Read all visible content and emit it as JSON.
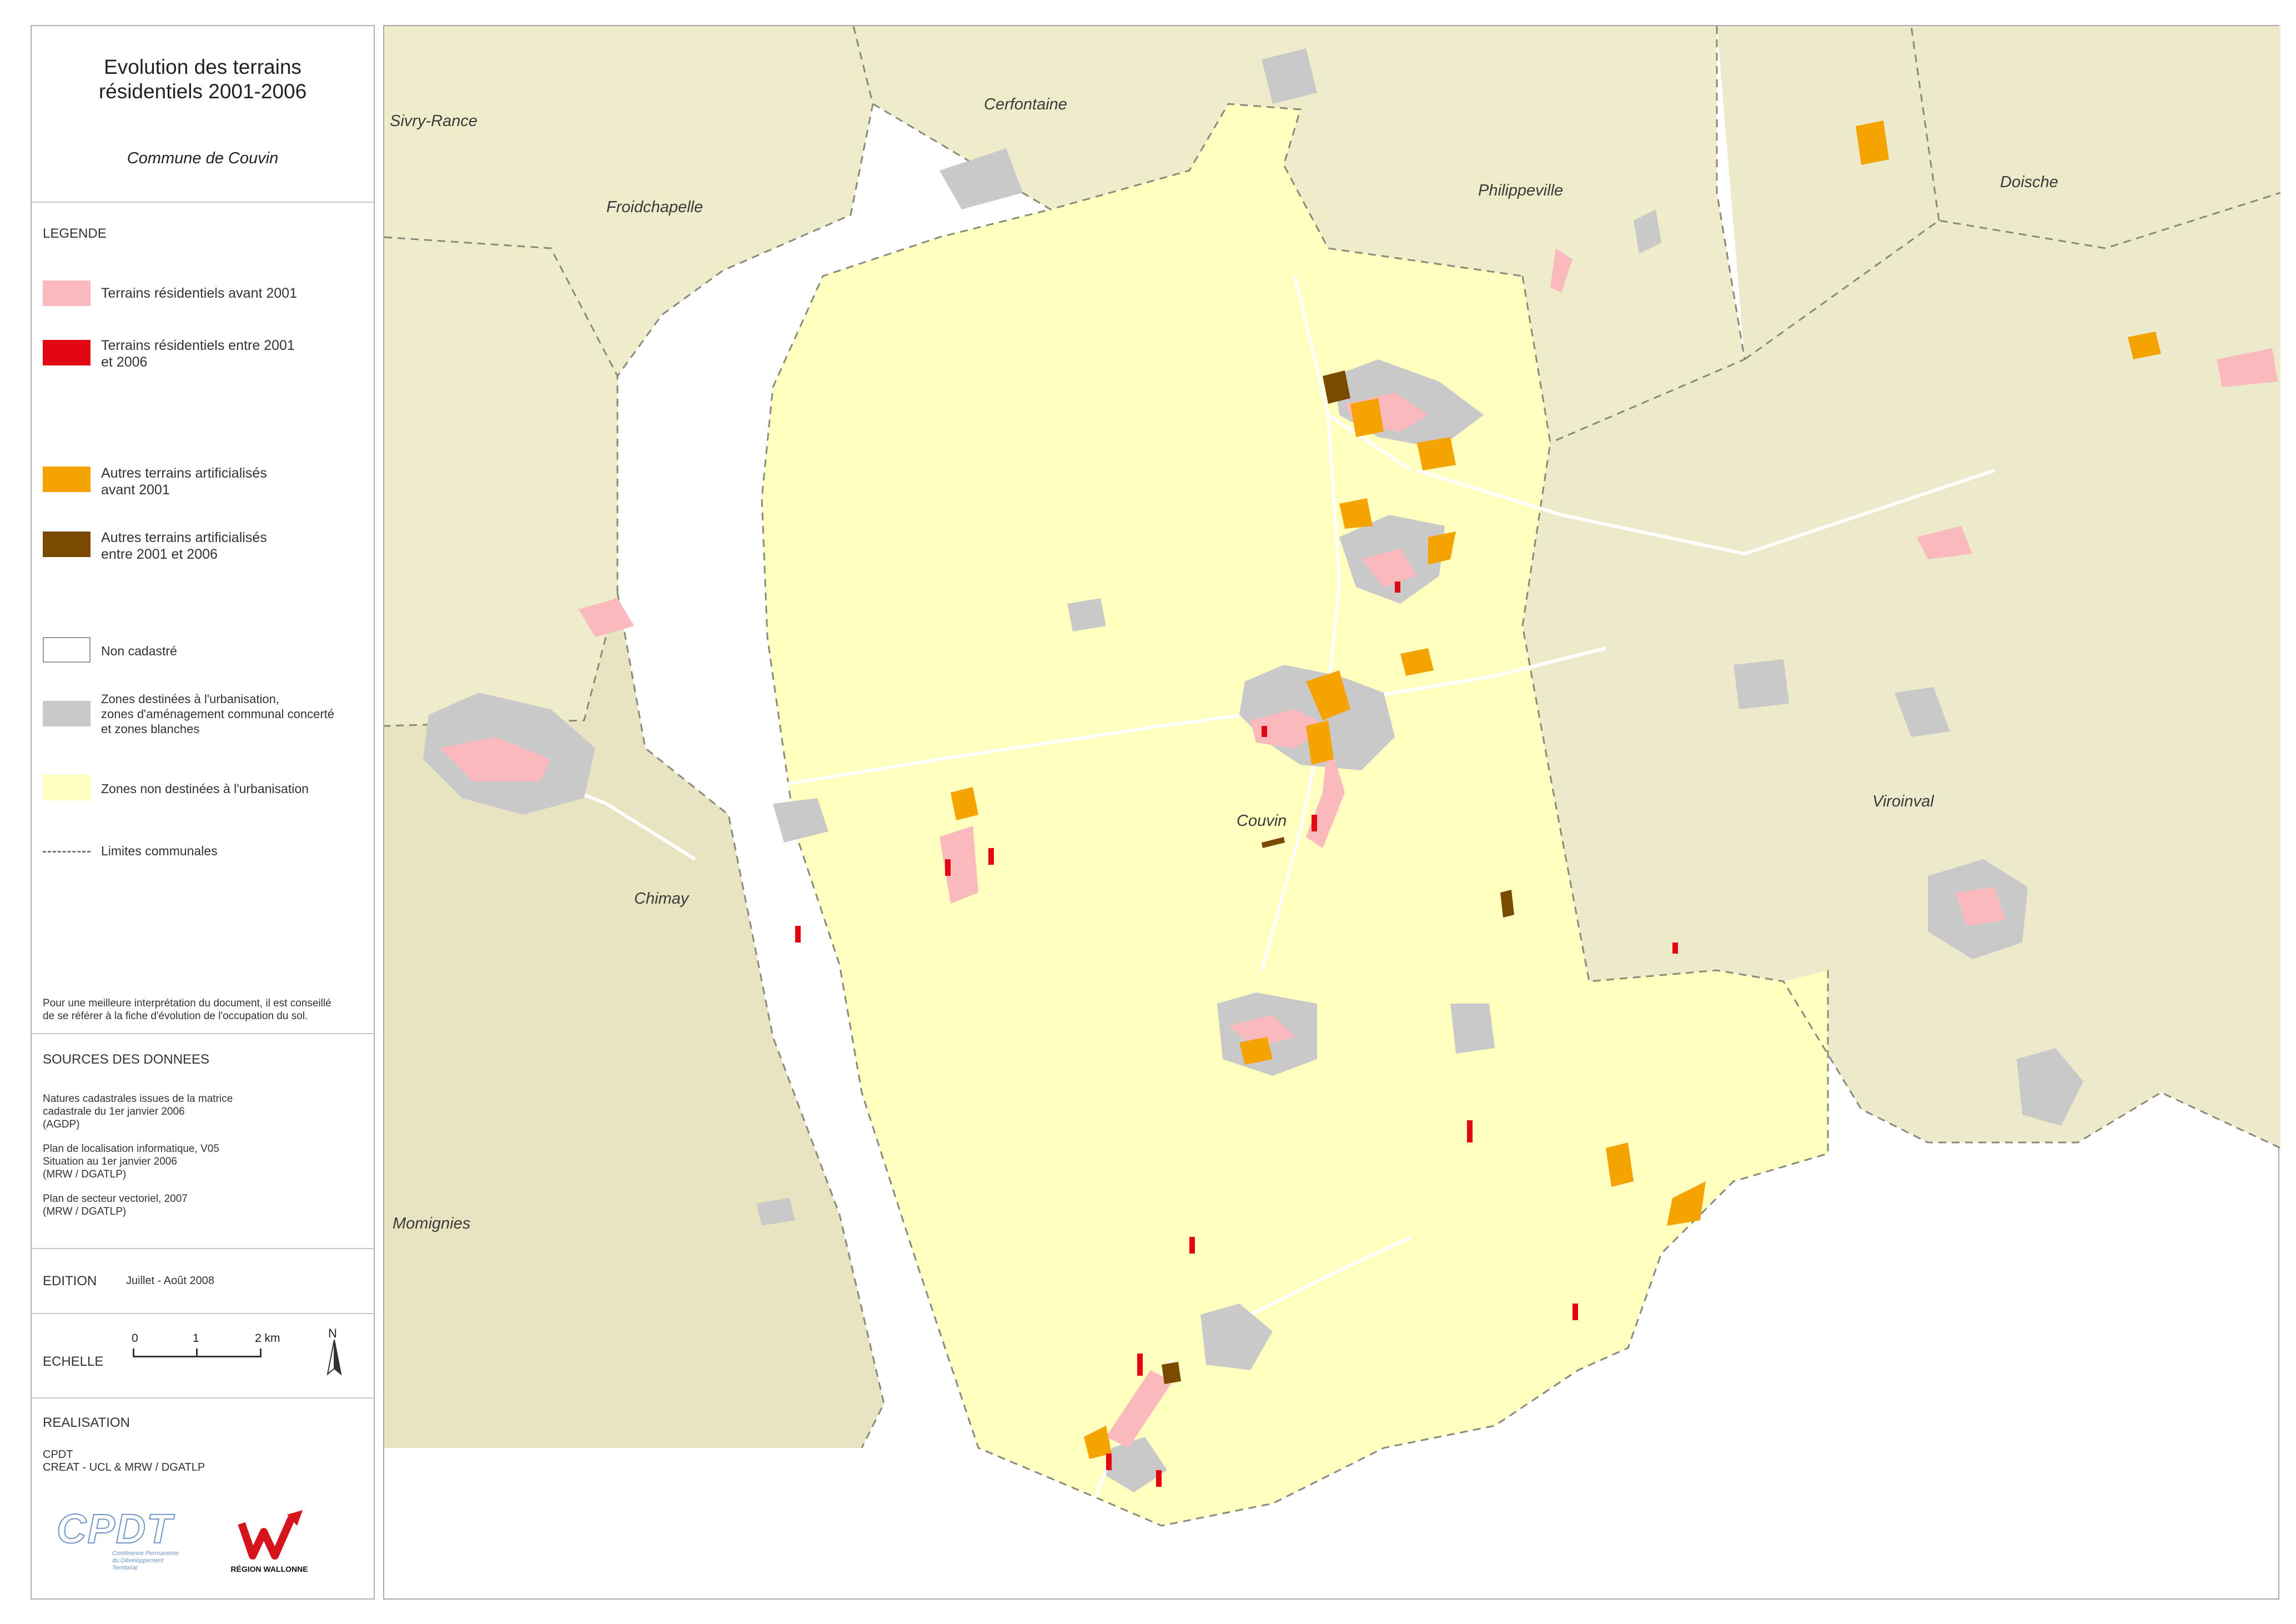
{
  "title_line1": "Evolution des terrains",
  "title_line2": "résidentiels 2001-2006",
  "subtitle": "Commune de Couvin",
  "legend": {
    "header": "LEGENDE",
    "items": [
      {
        "label": "Terrains résidentiels avant 2001",
        "color": "#f9b9bd"
      },
      {
        "label1": "Terrains résidentiels entre 2001",
        "label2": "et 2006",
        "color": "#e30613"
      },
      {
        "label1": "Autres terrains artificialisés",
        "label2": "avant 2001",
        "color": "#f4a300"
      },
      {
        "label1": "Autres terrains artificialisés",
        "label2": "entre 2001 et 2006",
        "color": "#7a4a00"
      },
      {
        "label": "Non cadastré",
        "color": "#ffffff"
      },
      {
        "label1": "Zones destinées à l'urbanisation,",
        "label2": "zones d'aménagement communal concerté",
        "label3": "et zones blanches",
        "color": "#c9c9c9"
      },
      {
        "label": "Zones non destinées à l'urbanisation",
        "color": "#ffffc0"
      },
      {
        "label": "Limites communales"
      }
    ],
    "note1": "Pour une meilleure interprétation du document, il est conseillé",
    "note2": "de se référer à la fiche d'évolution de l'occupation du sol."
  },
  "sources": {
    "header": "SOURCES DES DONNEES",
    "s1": [
      "Natures cadastrales issues de la matrice",
      "cadastrale du 1er janvier 2006",
      "(AGDP)"
    ],
    "s2": [
      "Plan de localisation informatique, V05",
      "Situation au 1er janvier 2006",
      "(MRW / DGATLP)"
    ],
    "s3": [
      "Plan de secteur vectoriel, 2007",
      "(MRW / DGATLP)"
    ]
  },
  "edition": {
    "label": "EDITION",
    "value": "Juillet - Août 2008"
  },
  "scale": {
    "label": "ECHELLE",
    "t0": "0",
    "t1": "1",
    "t2": "2 km",
    "north": "N"
  },
  "realisation": {
    "header": "REALISATION",
    "line1": "CPDT",
    "line2": "CREAT - UCL & MRW / DGATLP",
    "logo1_text": "CPDT",
    "logo1_sub1": "Conférence Permanente",
    "logo1_sub2": "du Développement",
    "logo1_sub3": "Territorial",
    "logo2_text": "RÉGION WALLONNE"
  },
  "places": {
    "sivry": "Sivry-Rance",
    "cerfontaine": "Cerfontaine",
    "froidchapelle": "Froidchapelle",
    "philippeville": "Philippeville",
    "doische": "Doische",
    "couvin": "Couvin",
    "viroinval": "Viroinval",
    "chimay": "Chimay",
    "momignies": "Momignies"
  },
  "colors": {
    "outside": "#eeeccb",
    "outside_dark": "#e6e2bd",
    "commune": "#ffffc0",
    "urban_zone": "#c9c9c9",
    "residential_old": "#f9b9bd",
    "residential_new": "#e30613",
    "artificial_old": "#f4a300",
    "artificial_new": "#7a4a00"
  }
}
